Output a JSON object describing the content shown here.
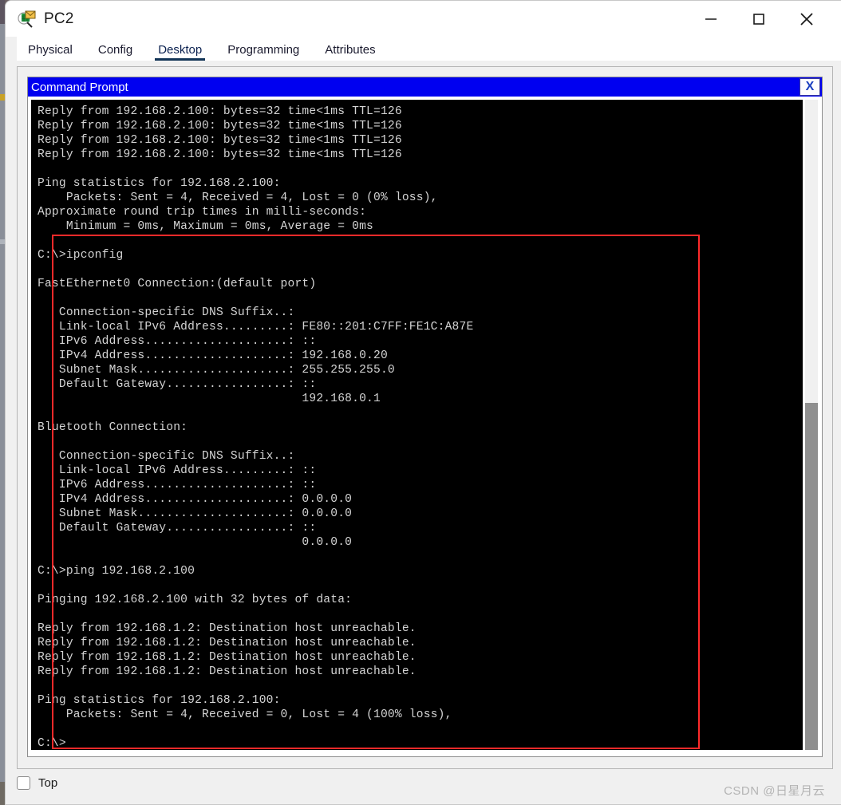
{
  "window": {
    "title": "PC2",
    "icon": "pc-device-icon",
    "minimize_label": "—",
    "maximize_label": "□",
    "close_label": "✕"
  },
  "tabs": [
    {
      "label": "Physical",
      "selected": false
    },
    {
      "label": "Config",
      "selected": false
    },
    {
      "label": "Desktop",
      "selected": true
    },
    {
      "label": "Programming",
      "selected": false
    },
    {
      "label": "Attributes",
      "selected": false
    }
  ],
  "command_prompt": {
    "title": "Command Prompt",
    "close_label": "X",
    "terminal_text": "Reply from 192.168.2.100: bytes=32 time<1ms TTL=126\nReply from 192.168.2.100: bytes=32 time<1ms TTL=126\nReply from 192.168.2.100: bytes=32 time<1ms TTL=126\nReply from 192.168.2.100: bytes=32 time<1ms TTL=126\n\nPing statistics for 192.168.2.100:\n    Packets: Sent = 4, Received = 4, Lost = 0 (0% loss),\nApproximate round trip times in milli-seconds:\n    Minimum = 0ms, Maximum = 0ms, Average = 0ms\n\nC:\\>ipconfig\n\nFastEthernet0 Connection:(default port)\n\n   Connection-specific DNS Suffix..:\n   Link-local IPv6 Address.........: FE80::201:C7FF:FE1C:A87E\n   IPv6 Address....................: ::\n   IPv4 Address....................: 192.168.0.20\n   Subnet Mask.....................: 255.255.255.0\n   Default Gateway.................: ::\n                                     192.168.0.1\n\nBluetooth Connection:\n\n   Connection-specific DNS Suffix..:\n   Link-local IPv6 Address.........: ::\n   IPv6 Address....................: ::\n   IPv4 Address....................: 0.0.0.0\n   Subnet Mask.....................: 0.0.0.0\n   Default Gateway.................: ::\n                                     0.0.0.0\n\nC:\\>ping 192.168.2.100\n\nPinging 192.168.2.100 with 32 bytes of data:\n\nReply from 192.168.1.2: Destination host unreachable.\nReply from 192.168.1.2: Destination host unreachable.\nReply from 192.168.1.2: Destination host unreachable.\nReply from 192.168.1.2: Destination host unreachable.\n\nPing statistics for 192.168.2.100:\n    Packets: Sent = 4, Received = 0, Lost = 4 (100% loss),\n\nC:\\>",
    "highlight_color": "#ff2a2a",
    "background_color": "#000000",
    "text_color": "#d4d4d4",
    "titlebar_color": "#0000f0"
  },
  "bottom": {
    "top_checkbox_label": "Top",
    "top_checkbox_checked": false,
    "watermark": "CSDN @日星月云"
  }
}
